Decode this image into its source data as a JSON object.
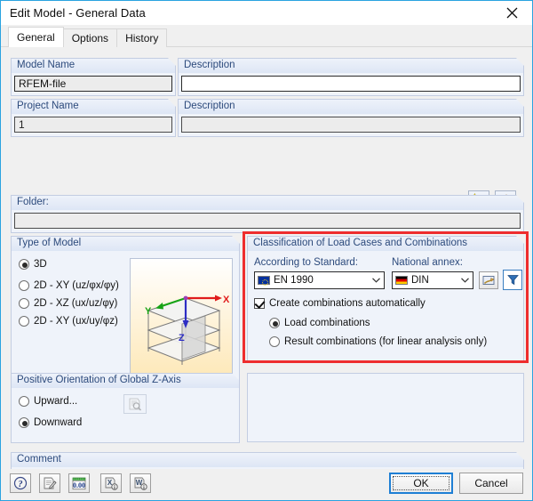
{
  "window": {
    "title": "Edit Model - General Data",
    "close_icon": "close-icon"
  },
  "tabs": [
    {
      "label": "General",
      "active": true
    },
    {
      "label": "Options",
      "active": false
    },
    {
      "label": "History",
      "active": false
    }
  ],
  "general": {
    "model_name_label": "Model Name",
    "model_name_value": "RFEM-file",
    "model_description_label": "Description",
    "model_description_value": "",
    "project_name_label": "Project Name",
    "project_name_value": "1",
    "project_description_label": "Description",
    "project_description_value": "",
    "folder_label": "Folder:",
    "folder_value": "",
    "new_project_icon": "new-project-box-icon",
    "open_project_icon": "project-box-icon"
  },
  "type_of_model": {
    "title": "Type of Model",
    "options": [
      {
        "label": "3D",
        "selected": true
      },
      {
        "label": "2D - XY (uz/φx/φy)",
        "selected": false
      },
      {
        "label": "2D - XZ (ux/uz/φy)",
        "selected": false
      },
      {
        "label": "2D - XY (ux/uy/φz)",
        "selected": false
      }
    ],
    "preview": {
      "axis_x": "X",
      "axis_y": "Y",
      "axis_z": "Z",
      "color_x": "#e01b1b",
      "color_y": "#17a317",
      "color_z": "#2d2dc4"
    }
  },
  "classification": {
    "title": "Classification of Load Cases and Combinations",
    "standard_label": "According to Standard:",
    "standard_value": "EN 1990",
    "standard_flag": "eu-flag-icon",
    "annex_label": "National annex:",
    "annex_value": "DIN",
    "annex_flag": "germany-flag-icon",
    "settings_icon": "annex-settings-icon",
    "filter_icon": "filter-funnel-icon",
    "auto_checkbox_label": "Create combinations automatically",
    "auto_checked": true,
    "sub_options": [
      {
        "label": "Load combinations",
        "selected": true
      },
      {
        "label": "Result combinations (for linear analysis only)",
        "selected": false
      }
    ],
    "highlight_color": "#ee2d2d"
  },
  "z_axis": {
    "title": "Positive Orientation of Global Z-Axis",
    "options": [
      {
        "label": "Upward...",
        "selected": false
      },
      {
        "label": "Downward",
        "selected": true
      }
    ],
    "preview_icon": "zoom-document-icon"
  },
  "comment": {
    "label": "Comment",
    "value": "",
    "picker_icon": "comment-library-icon"
  },
  "toolbar": [
    {
      "name": "help-button",
      "icon": "question-mark-icon"
    },
    {
      "name": "edit-button",
      "icon": "pencil-document-icon"
    },
    {
      "name": "units-button",
      "icon": "units-0-00-icon"
    },
    {
      "name": "export-excel-button",
      "icon": "export-x-icon"
    },
    {
      "name": "export-word-button",
      "icon": "export-w-icon"
    }
  ],
  "footer": {
    "ok_label": "OK",
    "cancel_label": "Cancel"
  }
}
